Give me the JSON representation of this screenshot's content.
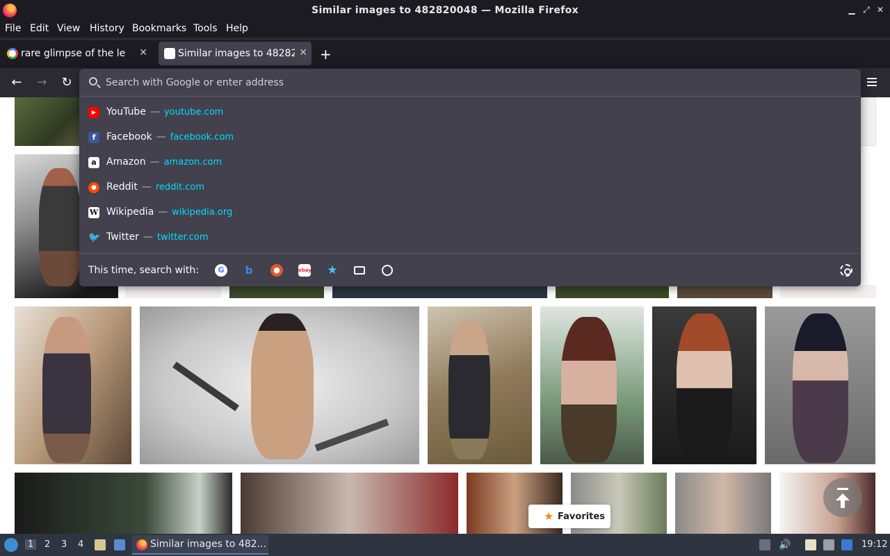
{
  "window": {
    "title": "Similar images to 482820048 — Mozilla Firefox",
    "minimize": "▁",
    "maximize": "⤢",
    "close": "✕"
  },
  "menu": [
    "File",
    "Edit",
    "View",
    "History",
    "Bookmarks",
    "Tools",
    "Help"
  ],
  "tabs": [
    {
      "title": "rare glimpse of the legen",
      "favicon": "google-icon",
      "active": false
    },
    {
      "title": "Similar images to 48282",
      "favicon": "site-icon",
      "active": true
    }
  ],
  "nav": {
    "back": "←",
    "forward": "→",
    "reload": "↻"
  },
  "urlbar": {
    "placeholder": "Search with Google or enter address",
    "suggestions": [
      {
        "name": "YouTube",
        "url": "youtube.com",
        "icon": "youtube-icon",
        "color": "#ff0000",
        "glyph": "▶"
      },
      {
        "name": "Facebook",
        "url": "facebook.com",
        "icon": "facebook-icon",
        "color": "#3b5998",
        "glyph": "f"
      },
      {
        "name": "Amazon",
        "url": "amazon.com",
        "icon": "amazon-icon",
        "color": "#ffffff",
        "glyph": "a"
      },
      {
        "name": "Reddit",
        "url": "reddit.com",
        "icon": "reddit-icon",
        "color": "#ff4500",
        "glyph": "●"
      },
      {
        "name": "Wikipedia",
        "url": "wikipedia.org",
        "icon": "wikipedia-icon",
        "color": "#ffffff",
        "glyph": "W"
      },
      {
        "name": "Twitter",
        "url": "twitter.com",
        "icon": "twitter-icon",
        "color": "#1da1f2",
        "glyph": "t"
      }
    ],
    "dash": "—",
    "search_with_label": "This time, search with:",
    "engines": [
      "google-icon",
      "bing-icon",
      "duckduckgo-icon",
      "ebay-icon",
      "bookmarks-icon",
      "tabs-icon",
      "history-icon"
    ]
  },
  "page": {
    "favorites_label": "Favorites"
  },
  "taskbar": {
    "workspaces": [
      "1",
      "2",
      "3",
      "4"
    ],
    "app_label": "Similar images to 482...",
    "clock": "19:12"
  }
}
